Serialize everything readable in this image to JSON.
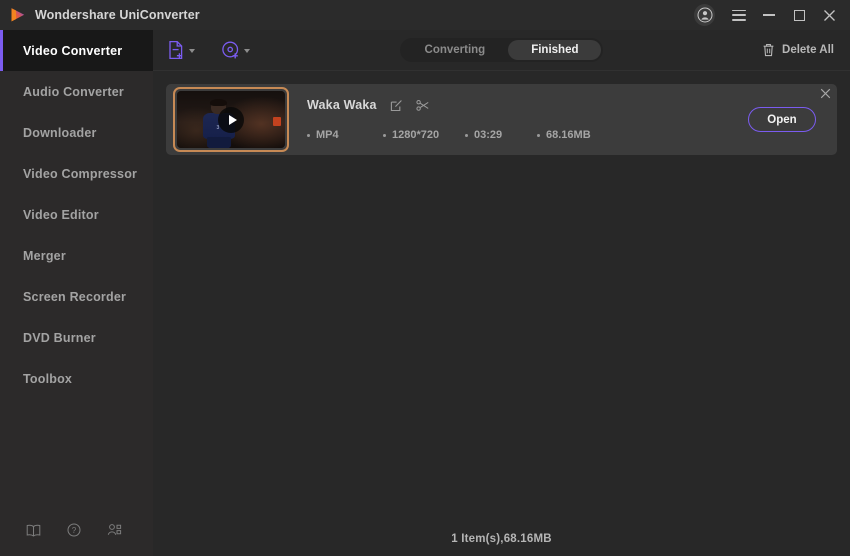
{
  "window": {
    "title": "Wondershare UniConverter",
    "logo_colors": [
      "#f08a2a",
      "#7b5cf0"
    ],
    "controls": {
      "account_icon": "account-avatar-icon",
      "menu_icon": "hamburger-menu-icon",
      "minimize_icon": "minimize-icon",
      "maximize_icon": "maximize-icon",
      "close_icon": "close-icon"
    }
  },
  "sidebar": {
    "items": [
      {
        "label": "Video Converter",
        "active": true
      },
      {
        "label": "Audio Converter",
        "active": false
      },
      {
        "label": "Downloader",
        "active": false
      },
      {
        "label": "Video Compressor",
        "active": false
      },
      {
        "label": "Video Editor",
        "active": false
      },
      {
        "label": "Merger",
        "active": false
      },
      {
        "label": "Screen Recorder",
        "active": false
      },
      {
        "label": "DVD Burner",
        "active": false
      },
      {
        "label": "Toolbox",
        "active": false
      }
    ],
    "active_accent": "#7b5cf0",
    "bottom_icons": [
      "guide-book-icon",
      "help-question-icon",
      "community-people-icon"
    ]
  },
  "toolbar": {
    "add_file_icon": "add-file-icon",
    "add_dvd_icon": "add-dvd-icon",
    "tabs": [
      {
        "label": "Converting",
        "active": false
      },
      {
        "label": "Finished",
        "active": true
      }
    ],
    "delete_all_label": "Delete All",
    "delete_all_icon": "trash-icon",
    "accent": "#7b5cf0"
  },
  "file": {
    "name": "Waka Waka",
    "edit_icon": "edit-icon",
    "trim_icon": "trim-scissors-icon",
    "play_icon": "play-icon",
    "close_icon": "remove-item-icon",
    "meta": {
      "format": "MP4",
      "resolution": "1280*720",
      "duration": "03:29",
      "size": "68.16MB"
    },
    "open_label": "Open",
    "thumbnail_border": "#c78a55"
  },
  "status": {
    "summary": "1 Item(s),68.16MB"
  }
}
